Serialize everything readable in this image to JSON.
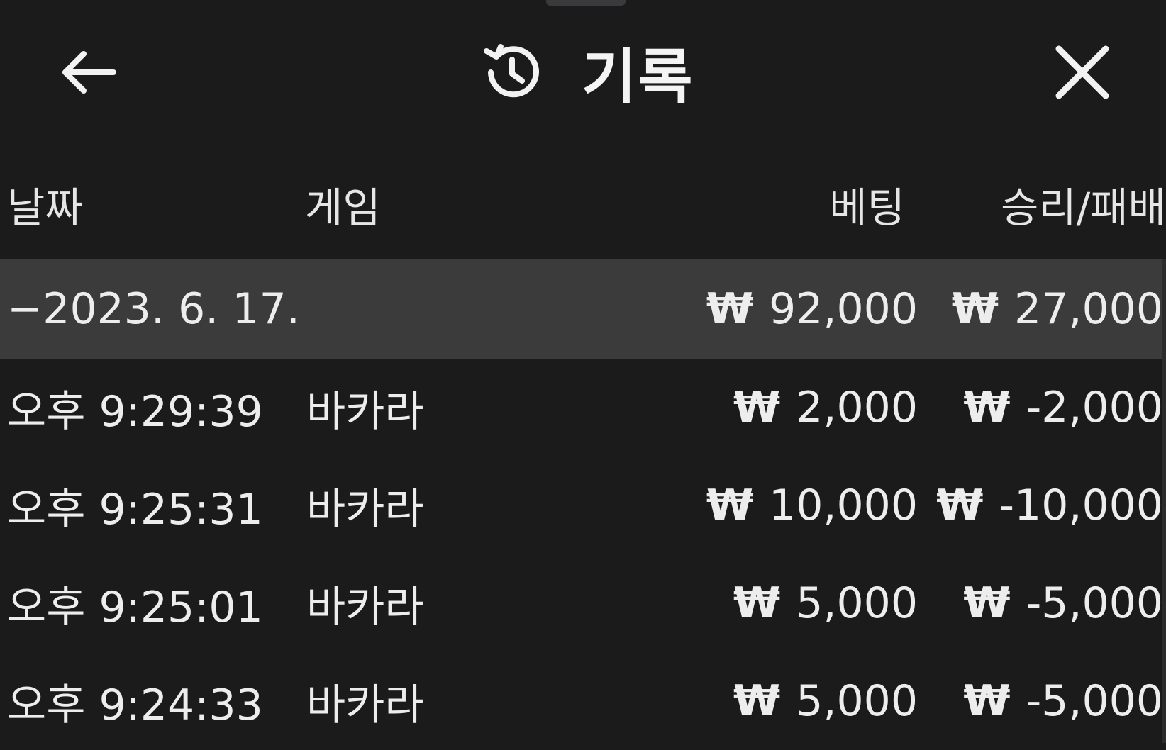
{
  "header": {
    "title": "기록",
    "back_icon": "arrow-left-icon",
    "history_icon": "history-icon",
    "close_icon": "close-icon"
  },
  "columns": {
    "date": "날짜",
    "game": "게임",
    "bet": "베팅",
    "result": "승리/패배"
  },
  "currency_symbol": "₩",
  "summary": {
    "date": "−2023. 6. 17.",
    "bet": "92,000",
    "result": "27,000"
  },
  "rows": [
    {
      "time": "오후 9:29:39",
      "game": "바카라",
      "bet": "2,000",
      "result": "-2,000"
    },
    {
      "time": "오후 9:25:31",
      "game": "바카라",
      "bet": "10,000",
      "result": "-10,000"
    },
    {
      "time": "오후 9:25:01",
      "game": "바카라",
      "bet": "5,000",
      "result": "-5,000"
    },
    {
      "time": "오후 9:24:33",
      "game": "바카라",
      "bet": "5,000",
      "result": "-5,000"
    }
  ]
}
